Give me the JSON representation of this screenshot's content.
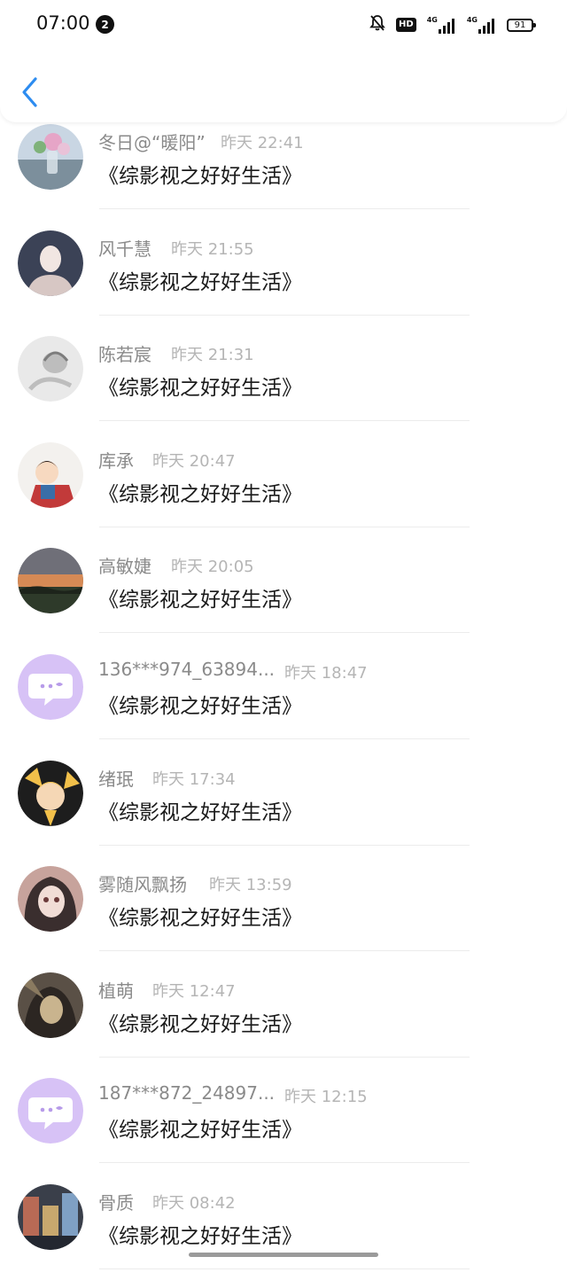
{
  "status_bar": {
    "time": "07:00",
    "notification_count": "2",
    "network_badge": "HD",
    "sim1": "4G",
    "sim2": "4G",
    "battery": "91"
  },
  "messages": [
    {
      "name": "冬日@“暖阳”",
      "time": "昨天 22:41",
      "text": "《综影视之好好生活》",
      "avatar": {
        "type": "photo-flowers",
        "colors": [
          "#c9d6e3",
          "#7c8f9c",
          "#e6a5c7"
        ]
      }
    },
    {
      "name": "风千慧",
      "time": "昨天 21:55",
      "text": "《综影视之好好生活》",
      "avatar": {
        "type": "photo-portrait",
        "colors": [
          "#3b4256",
          "#f1e6e2",
          "#d7c7c4"
        ]
      }
    },
    {
      "name": "陈若宸",
      "time": "昨天 21:31",
      "text": "《综影视之好好生活》",
      "avatar": {
        "type": "photo-sketch",
        "colors": [
          "#e9e9e9",
          "#bdbdbd",
          "#7d7d7d"
        ]
      }
    },
    {
      "name": "库承",
      "time": "昨天 20:47",
      "text": "《综影视之好好生活》",
      "avatar": {
        "type": "cartoon-boy",
        "colors": [
          "#f3f1ee",
          "#c23a3a",
          "#3a6ea8"
        ]
      }
    },
    {
      "name": "高敏婕",
      "time": "昨天 20:05",
      "text": "《综影视之好好生活》",
      "avatar": {
        "type": "photo-sunset",
        "colors": [
          "#6f6f78",
          "#d68a55",
          "#2e3a2a"
        ]
      }
    },
    {
      "name": "136***974_63894...",
      "time": "昨天 18:47",
      "text": "《综影视之好好生活》",
      "avatar": {
        "type": "default-chat",
        "colors": [
          "#d7c2f6",
          "#ffffff",
          "#b79be9"
        ]
      }
    },
    {
      "name": "绪珉",
      "time": "昨天 17:34",
      "text": "《综影视之好好生活》",
      "avatar": {
        "type": "cartoon-yellow",
        "colors": [
          "#1d1d1d",
          "#f2c04a",
          "#f5d7b5"
        ]
      }
    },
    {
      "name": "雾随风飘扬",
      "time": "昨天 13:59",
      "text": "《综影视之好好生活》",
      "avatar": {
        "type": "anime-girl",
        "colors": [
          "#3a2e2e",
          "#c7a39c",
          "#f1ddd6"
        ]
      }
    },
    {
      "name": "植萌",
      "time": "昨天 12:47",
      "text": "《综影视之好好生活》",
      "avatar": {
        "type": "anime-dark",
        "colors": [
          "#5a5046",
          "#c9b48e",
          "#2c2622"
        ]
      }
    },
    {
      "name": "187***872_24897...",
      "time": "昨天 12:15",
      "text": "《综影视之好好生活》",
      "avatar": {
        "type": "default-chat",
        "colors": [
          "#d7c2f6",
          "#ffffff",
          "#b79be9"
        ]
      }
    },
    {
      "name": "骨质",
      "time": "昨天 08:42",
      "text": "《综影视之好好生活》",
      "avatar": {
        "type": "photo-street",
        "colors": [
          "#3a3f4a",
          "#b86a55",
          "#7fa0c4"
        ]
      }
    }
  ],
  "theme": {
    "accent": "#2d8cf0",
    "name_color": "#8a8a8a",
    "time_color": "#b5b5b5",
    "text_color": "#1a1a1a"
  },
  "icons": {
    "back": "chevron-left-icon",
    "silent": "bell-off-icon"
  }
}
